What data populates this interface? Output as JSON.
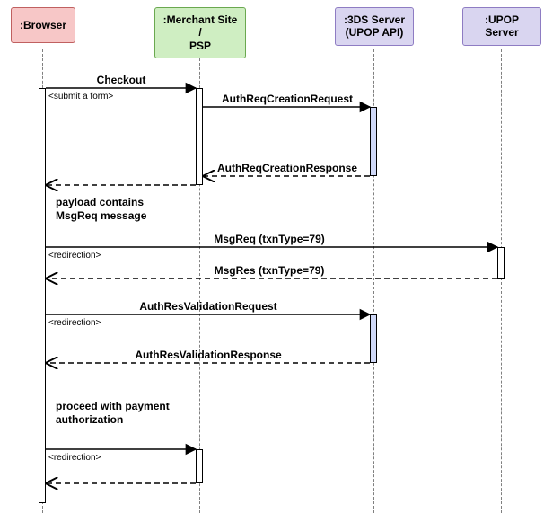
{
  "participants": {
    "browser": {
      "label": ":Browser",
      "bg": "#f7c7c7",
      "border": "#c06060"
    },
    "merchant": {
      "label": ":Merchant Site /\nPSP",
      "bg": "#cfeec2",
      "border": "#6aa84f"
    },
    "tds": {
      "label": ":3DS Server\n(UPOP API)",
      "bg": "#d9d5f0",
      "border": "#8e7cc3"
    },
    "upop": {
      "label": ":UPOP Server",
      "bg": "#d9d5f0",
      "border": "#8e7cc3"
    }
  },
  "messages": {
    "m1": "Checkout",
    "m2": "AuthReqCreationRequest",
    "m3": "AuthReqCreationResponse",
    "m4": "MsgReq (txnType=79)",
    "m5": "MsgRes (txnType=79)",
    "m6": "AuthResValidationRequest",
    "m7": "AuthResValidationResponse",
    "m8_return": "",
    "m9_return": ""
  },
  "guards": {
    "g1": "<submit a form>",
    "g2": "<redirection>",
    "g3": "<redirection>",
    "g4": "<redirection>"
  },
  "notes": {
    "n1": "payload contains\nMsgReq message",
    "n2": "proceed with payment\nauthorization"
  },
  "chart_data": {
    "type": "sequence-diagram",
    "participants": [
      "Browser",
      "Merchant Site / PSP",
      "3DS Server (UPOP API)",
      "UPOP Server"
    ],
    "interactions": [
      {
        "from": "Browser",
        "to": "Merchant Site / PSP",
        "label": "Checkout",
        "guard": "submit a form",
        "kind": "sync"
      },
      {
        "from": "Merchant Site / PSP",
        "to": "3DS Server (UPOP API)",
        "label": "AuthReqCreationRequest",
        "kind": "sync"
      },
      {
        "from": "3DS Server (UPOP API)",
        "to": "Merchant Site / PSP",
        "label": "AuthReqCreationResponse",
        "kind": "return"
      },
      {
        "note": "payload contains MsgReq message",
        "near": "Browser"
      },
      {
        "from": "Browser",
        "to": "UPOP Server",
        "label": "MsgReq (txnType=79)",
        "guard": "redirection",
        "kind": "sync"
      },
      {
        "from": "UPOP Server",
        "to": "Browser",
        "label": "MsgRes (txnType=79)",
        "kind": "return"
      },
      {
        "from": "Browser",
        "to": "3DS Server (UPOP API)",
        "label": "AuthResValidationRequest",
        "guard": "redirection",
        "kind": "sync"
      },
      {
        "from": "3DS Server (UPOP API)",
        "to": "Browser",
        "label": "AuthResValidationResponse",
        "kind": "return"
      },
      {
        "note": "proceed with payment authorization",
        "near": "Browser"
      },
      {
        "from": "Browser",
        "to": "Merchant Site / PSP",
        "label": "",
        "guard": "redirection",
        "kind": "sync"
      },
      {
        "from": "Merchant Site / PSP",
        "to": "Browser",
        "label": "",
        "kind": "return"
      }
    ]
  }
}
